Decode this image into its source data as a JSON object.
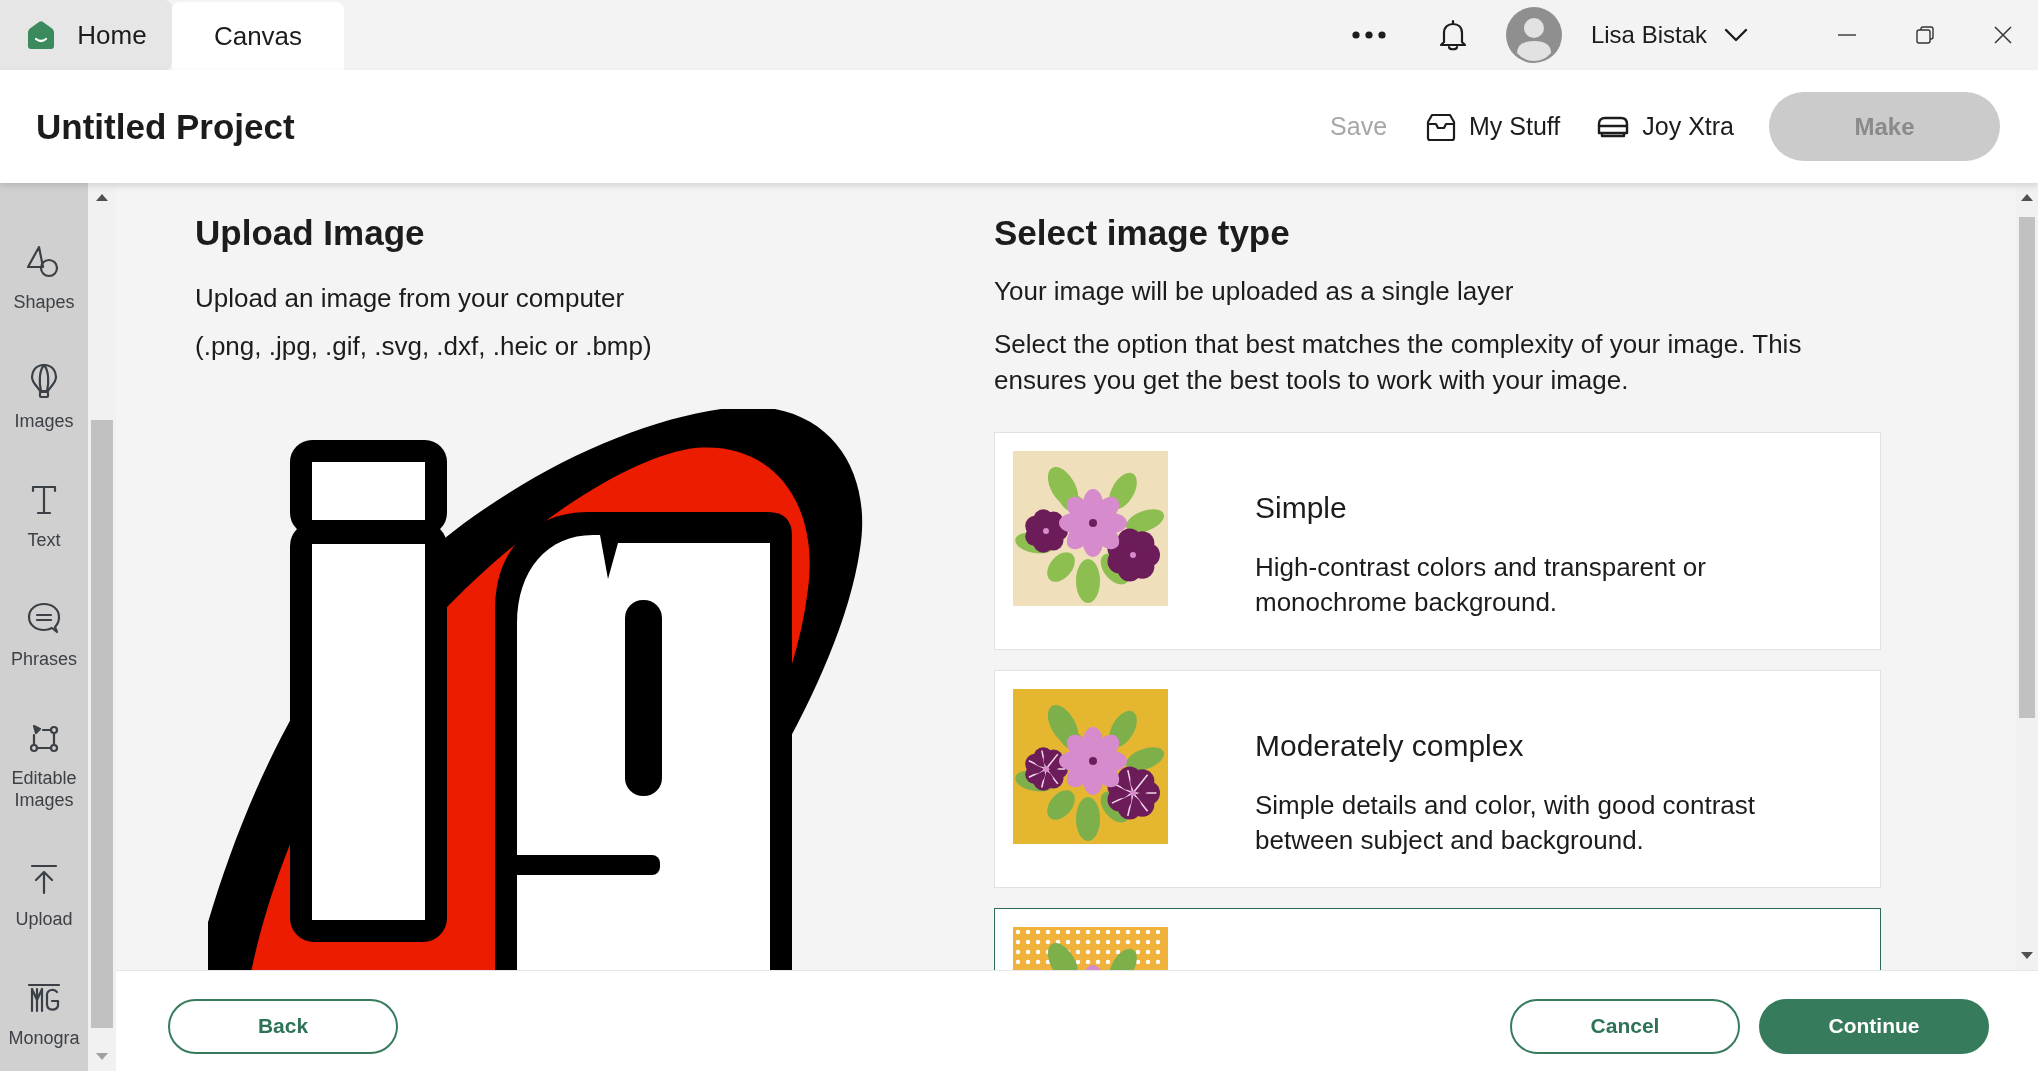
{
  "tabs": [
    {
      "label": "Home",
      "kind": "home",
      "selected": false
    },
    {
      "label": "Canvas",
      "kind": "plain",
      "selected": true
    }
  ],
  "account": {
    "name": "Lisa Bistak"
  },
  "header": {
    "title": "Untitled Project",
    "save": {
      "label": "Save",
      "disabled": true
    },
    "my_stuff": {
      "label": "My Stuff"
    },
    "machine": {
      "label": "Joy Xtra"
    },
    "make": {
      "label": "Make",
      "disabled": true
    }
  },
  "sidebar": {
    "items": [
      {
        "label": "Shapes",
        "kind": "shapes"
      },
      {
        "label": "Images",
        "kind": "images"
      },
      {
        "label": "Text",
        "kind": "text"
      },
      {
        "label": "Phrases",
        "kind": "phrases"
      },
      {
        "label": "Editable Images",
        "kind": "editable"
      },
      {
        "label": "Upload",
        "kind": "upload"
      },
      {
        "label": "Monogra",
        "kind": "monogram"
      }
    ]
  },
  "upload": {
    "title": "Upload Image",
    "instruction": "Upload an image from your computer",
    "formats": "(.png, .jpg, .gif, .svg, .dxf, .heic or .bmp)"
  },
  "image_type": {
    "title": "Select image type",
    "subtitle": "Your image will be uploaded as a single layer",
    "description": "Select the option that best matches the complexity of your image. This ensures you get the best tools to work with your image.",
    "options": [
      {
        "kind": "simple",
        "title": "Simple",
        "description": "High-contrast colors and transparent or monochrome background.",
        "selected": false
      },
      {
        "kind": "moderate",
        "title": "Moderately complex",
        "description": "Simple details and color, with good contrast between subject and background.",
        "selected": false
      },
      {
        "kind": "complex",
        "selected": true
      }
    ]
  },
  "footer": {
    "back": {
      "label": "Back",
      "kind": "outline"
    },
    "cancel": {
      "label": "Cancel",
      "kind": "outline"
    },
    "continue": {
      "label": "Continue",
      "kind": "filled"
    }
  }
}
